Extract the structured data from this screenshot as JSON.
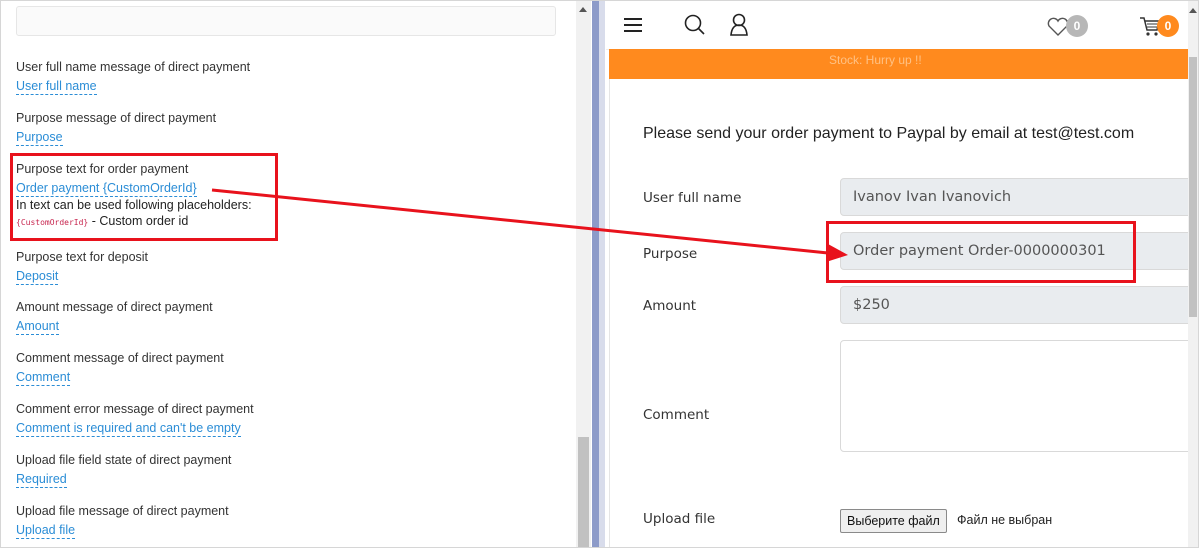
{
  "left_panel": {
    "fields": [
      {
        "label": "User full name message of direct payment",
        "value": "User full name"
      },
      {
        "label": "Purpose message of direct payment",
        "value": "Purpose"
      },
      {
        "label": "Purpose text for order payment",
        "value": "Order payment {CustomOrderId}"
      },
      {
        "label": "Purpose text for deposit",
        "value": "Deposit"
      },
      {
        "label": "Amount message of direct payment",
        "value": "Amount"
      },
      {
        "label": "Comment message of direct payment",
        "value": "Comment"
      },
      {
        "label": "Comment error message of direct payment",
        "value": "Comment is required and can't be empty"
      },
      {
        "label": "Upload file field state of direct payment",
        "value": "Required"
      },
      {
        "label": "Upload file message of direct payment",
        "value": "Upload file"
      }
    ],
    "placeholder_help": "In text can be used following placeholders:",
    "placeholder_code": "{CustomOrderId}",
    "placeholder_desc": " - Custom order id"
  },
  "shop": {
    "header": {
      "menu_icon": "hamburger-icon",
      "search_icon": "search-icon",
      "user_icon": "user-icon",
      "wishlist_icon": "heart-icon",
      "wishlist_count": "0",
      "cart_icon": "cart-icon",
      "cart_count": "0"
    },
    "banner_text": "Stock: Hurry up !!",
    "intro": "Please send your order payment to Paypal by email at test@test.com",
    "form": {
      "user_full_name_label": "User full name",
      "user_full_name_value": "Ivanov Ivan Ivanovich",
      "purpose_label": "Purpose",
      "purpose_value": "Order payment Order-0000000301",
      "amount_label": "Amount",
      "amount_value": "$250",
      "comment_label": "Comment",
      "upload_label": "Upload file",
      "file_button": "Выберите файл",
      "file_status": "Файл не выбран"
    }
  },
  "colors": {
    "link": "#2b8dd6",
    "annotation": "#e8121c",
    "banner": "#ff8a1e",
    "badge_grey": "#b7b7b7",
    "badge_orange": "#ff8a1e"
  }
}
